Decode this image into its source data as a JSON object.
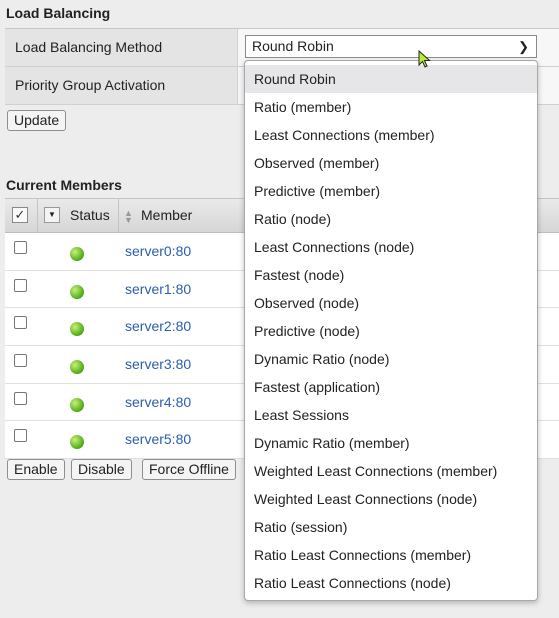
{
  "section_title": "Load Balancing",
  "properties": {
    "method_label": "Load Balancing Method",
    "method_value": "Round Robin",
    "priority_label": "Priority Group Activation"
  },
  "update_button": "Update",
  "members": {
    "title": "Current Members",
    "col_status": "Status",
    "col_member": "Member",
    "rows": [
      {
        "member": "server0:80",
        "status_color": "#4caa14"
      },
      {
        "member": "server1:80",
        "status_color": "#4caa14"
      },
      {
        "member": "server2:80",
        "status_color": "#4caa14"
      },
      {
        "member": "server3:80",
        "status_color": "#4caa14"
      },
      {
        "member": "server4:80",
        "status_color": "#4caa14"
      },
      {
        "member": "server5:80",
        "status_color": "#4caa14"
      }
    ]
  },
  "actions": {
    "enable": "Enable",
    "disable": "Disable",
    "force_offline": "Force Offline"
  },
  "dropdown_options": [
    "Round Robin",
    "Ratio (member)",
    "Least Connections (member)",
    "Observed (member)",
    "Predictive (member)",
    "Ratio (node)",
    "Least Connections (node)",
    "Fastest (node)",
    "Observed (node)",
    "Predictive (node)",
    "Dynamic Ratio (node)",
    "Fastest (application)",
    "Least Sessions",
    "Dynamic Ratio (member)",
    "Weighted Least Connections (member)",
    "Weighted Least Connections (node)",
    "Ratio (session)",
    "Ratio Least Connections (member)",
    "Ratio Least Connections (node)"
  ],
  "selected_option": "Round Robin",
  "link_color": "#2a5db0"
}
